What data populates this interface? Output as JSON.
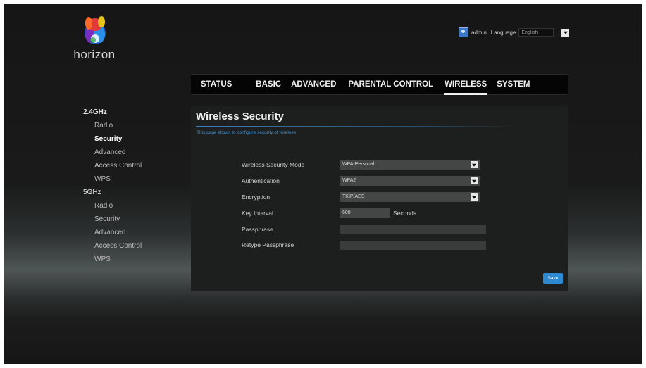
{
  "brand": {
    "name": "horizon"
  },
  "header": {
    "user": "admin",
    "language_label": "Language",
    "language_value": "English"
  },
  "nav": {
    "tabs": [
      {
        "label": "STATUS"
      },
      {
        "label": "BASIC"
      },
      {
        "label": "ADVANCED"
      },
      {
        "label": "PARENTAL CONTROL"
      },
      {
        "label": "WIRELESS"
      },
      {
        "label": "SYSTEM"
      }
    ],
    "active": "WIRELESS"
  },
  "sidebar": {
    "groups": [
      {
        "label": "2.4GHz",
        "items": [
          "Radio",
          "Security",
          "Advanced",
          "Access Control",
          "WPS"
        ]
      },
      {
        "label": "5GHz",
        "items": [
          "Radio",
          "Security",
          "Advanced",
          "Access Control",
          "WPS"
        ]
      }
    ],
    "active_item": "Security"
  },
  "panel": {
    "title": "Wireless Security",
    "description": "This page allows to configure security of wireless",
    "fields": {
      "mode": {
        "label": "Wireless Security Mode",
        "value": "WPA-Personal"
      },
      "auth": {
        "label": "Authentication",
        "value": "WPA2"
      },
      "encryption": {
        "label": "Encryption",
        "value": "TKIP/AES"
      },
      "key_interval": {
        "label": "Key Interval",
        "value": "600",
        "unit": "Seconds"
      },
      "passphrase": {
        "label": "Passphrase",
        "value": ""
      },
      "retype": {
        "label": "Retype Passphrase",
        "value": ""
      }
    },
    "save_label": "Save"
  },
  "colors": {
    "accent": "#2b8ad2",
    "panel_bg": "#1d1f1f",
    "nav_bg": "#050505"
  },
  "icons": {
    "logo": "horizon-logo-icon",
    "user": "user-icon",
    "dropdown": "dropdown-arrow-icon"
  }
}
